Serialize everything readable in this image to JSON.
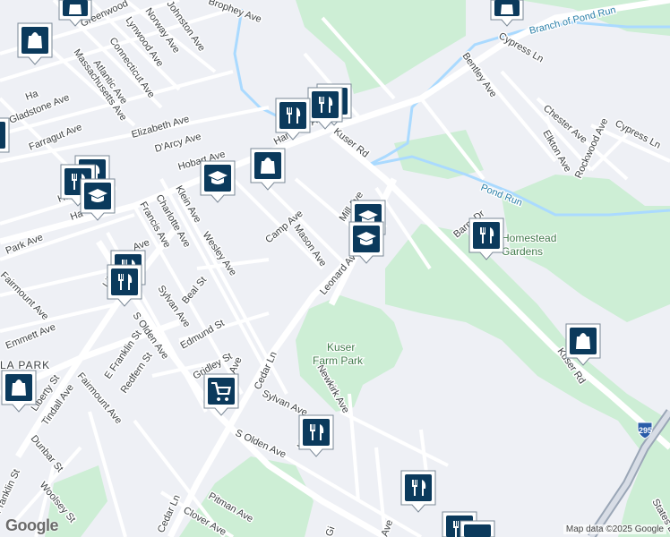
{
  "map": {
    "attribution": "Map data ©2025 Google",
    "logo_text": "Google",
    "highway_shield": "295",
    "colors": {
      "background": "#eef0f5",
      "park": "#cdeed5",
      "water": "#aadaff",
      "road": "#ffffff",
      "pin": "#0b3a5c"
    }
  },
  "parks": [
    {
      "name_line1": "Kuser",
      "name_line2": "Farm Park"
    },
    {
      "name_line1": "Homestead",
      "name_line2": "Gardens"
    }
  ],
  "water": [
    {
      "name": "Branch of Pond Run"
    },
    {
      "name": "Pond Run"
    }
  ],
  "streets": [
    "Greenwood",
    "Norway Ave",
    "Lynwood Ave",
    "Connecticut Ave",
    "Atlantic Ave",
    "Massachusetts Ave",
    "Gladstone Ave",
    "Farragut Ave",
    "Elizabeth Ave",
    "D'Arcy Ave",
    "Hobart Ave",
    "Hamilton Ave",
    "Kuser Rd",
    "Kuser Rd",
    "Cypress Ln",
    "Bentley Ave",
    "Chester Ave",
    "Cypress Ln",
    "Elkton Ave",
    "Rockwood Ave",
    "Klein Ave",
    "Francis Ave",
    "Charlotte Ave",
    "Camp Ave",
    "Mason Ave",
    "Leonard Ave",
    "Park Ave",
    "Fairmount Ave",
    "Liberty St",
    "Sylvan Ave",
    "Beal St",
    "Wesley Ave",
    "S Olden Ave",
    "Emmett Ave",
    "Edmund St",
    "E Franklin St",
    "Redfern St",
    "Gridley St",
    "Cedar Ln",
    "Newkirk Ave",
    "Sylvan Ave",
    "Fairmount Ave",
    "Tindall Ave",
    "Liberty St",
    "Dunbar St",
    "S Olden Ave",
    "Franklin St",
    "Woolsey St",
    "Pitman Ave",
    "Clover Ave",
    "Cedar Ln",
    "Mill Ave",
    "Barnt Dr",
    "States Blvd",
    "Brophey Ave",
    "Johnston Ave",
    "Ave",
    "Ha",
    "Ha",
    "Ave",
    "Ho",
    "Ha",
    "Gi",
    "Ave"
  ],
  "area_labels": [
    "LA PARK"
  ],
  "pins": [
    {
      "icon": "shopping-bag"
    },
    {
      "icon": "shopping-bag"
    },
    {
      "icon": "shopping-bag"
    },
    {
      "icon": "shopping-bag"
    },
    {
      "icon": "shopping-bag"
    },
    {
      "icon": "shopping-bag"
    },
    {
      "icon": "restaurant"
    },
    {
      "icon": "restaurant"
    },
    {
      "icon": "restaurant"
    },
    {
      "icon": "restaurant"
    },
    {
      "icon": "restaurant"
    },
    {
      "icon": "restaurant"
    },
    {
      "icon": "restaurant"
    },
    {
      "icon": "restaurant"
    },
    {
      "icon": "restaurant"
    },
    {
      "icon": "restaurant"
    },
    {
      "icon": "school"
    },
    {
      "icon": "school"
    },
    {
      "icon": "school"
    },
    {
      "icon": "school"
    },
    {
      "icon": "grocery-cart"
    },
    {
      "icon": "restaurant"
    }
  ]
}
